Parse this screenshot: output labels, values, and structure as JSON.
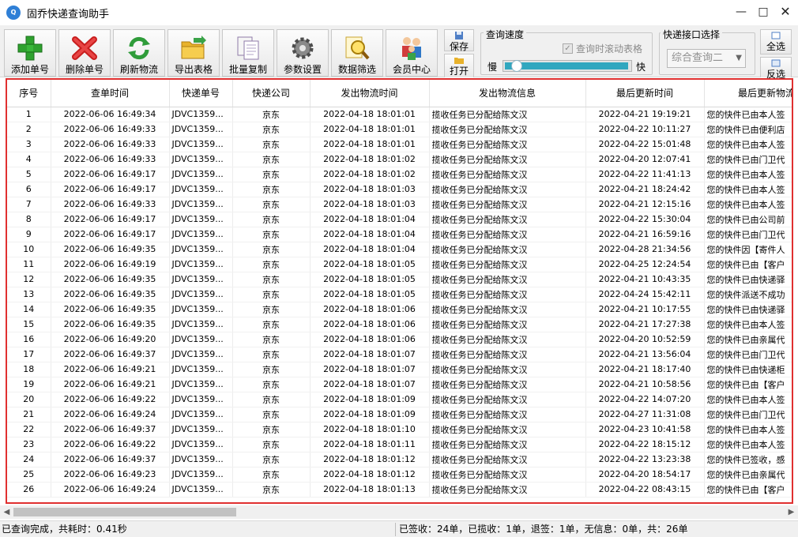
{
  "window": {
    "title": "固乔快递查询助手",
    "app_icon": "Q"
  },
  "toolbar": {
    "buttons": [
      {
        "label": "添加单号",
        "icon": "green-plus-icon"
      },
      {
        "label": "删除单号",
        "icon": "red-x-icon"
      },
      {
        "label": "刷新物流",
        "icon": "refresh-icon"
      },
      {
        "label": "导出表格",
        "icon": "folder-export-icon"
      },
      {
        "label": "批量复制",
        "icon": "copy-icon"
      },
      {
        "label": "参数设置",
        "icon": "gear-icon"
      },
      {
        "label": "数据筛选",
        "icon": "filter-search-icon"
      },
      {
        "label": "会员中心",
        "icon": "members-icon"
      }
    ],
    "save_label": "保存",
    "open_label": "打开",
    "speed": {
      "title": "查询速度",
      "scroll_checkbox_label": "查询时滚动表格",
      "scroll_checked": true,
      "slow_label": "慢",
      "fast_label": "快",
      "level": 0.06
    },
    "api": {
      "title": "快递接口选择",
      "selected": "综合查询二"
    },
    "select_all_label": "全选",
    "invert_label": "反选"
  },
  "grid": {
    "columns": [
      "序号",
      "查单时间",
      "快递单号",
      "快递公司",
      "发出物流时间",
      "发出物流信息",
      "最后更新时间",
      "最后更新物流"
    ],
    "rows": [
      [
        "1",
        "2022-06-06 16:49:34",
        "JDVC1359...",
        "京东",
        "2022-04-18 18:01:01",
        "揽收任务已分配给陈文汉",
        "2022-04-21 19:19:21",
        "您的快件已由本人签"
      ],
      [
        "2",
        "2022-06-06 16:49:33",
        "JDVC1359...",
        "京东",
        "2022-04-18 18:01:01",
        "揽收任务已分配给陈文汉",
        "2022-04-22 10:11:27",
        "您的快件已由便利店"
      ],
      [
        "3",
        "2022-06-06 16:49:33",
        "JDVC1359...",
        "京东",
        "2022-04-18 18:01:01",
        "揽收任务已分配给陈文汉",
        "2022-04-22 15:01:48",
        "您的快件已由本人签"
      ],
      [
        "4",
        "2022-06-06 16:49:33",
        "JDVC1359...",
        "京东",
        "2022-04-18 18:01:02",
        "揽收任务已分配给陈文汉",
        "2022-04-20 12:07:41",
        "您的快件已由门卫代"
      ],
      [
        "5",
        "2022-06-06 16:49:17",
        "JDVC1359...",
        "京东",
        "2022-04-18 18:01:02",
        "揽收任务已分配给陈文汉",
        "2022-04-22 11:41:13",
        "您的快件已由本人签"
      ],
      [
        "6",
        "2022-06-06 16:49:17",
        "JDVC1359...",
        "京东",
        "2022-04-18 18:01:03",
        "揽收任务已分配给陈文汉",
        "2022-04-21 18:24:42",
        "您的快件已由本人签"
      ],
      [
        "7",
        "2022-06-06 16:49:33",
        "JDVC1359...",
        "京东",
        "2022-04-18 18:01:03",
        "揽收任务已分配给陈文汉",
        "2022-04-21 12:15:16",
        "您的快件已由本人签"
      ],
      [
        "8",
        "2022-06-06 16:49:17",
        "JDVC1359...",
        "京东",
        "2022-04-18 18:01:04",
        "揽收任务已分配给陈文汉",
        "2022-04-22 15:30:04",
        "您的快件已由公司前"
      ],
      [
        "9",
        "2022-06-06 16:49:17",
        "JDVC1359...",
        "京东",
        "2022-04-18 18:01:04",
        "揽收任务已分配给陈文汉",
        "2022-04-21 16:59:16",
        "您的快件已由门卫代"
      ],
      [
        "10",
        "2022-06-06 16:49:35",
        "JDVC1359...",
        "京东",
        "2022-04-18 18:01:04",
        "揽收任务已分配给陈文汉",
        "2022-04-28 21:34:56",
        "您的快件因【寄件人"
      ],
      [
        "11",
        "2022-06-06 16:49:19",
        "JDVC1359...",
        "京东",
        "2022-04-18 18:01:05",
        "揽收任务已分配给陈文汉",
        "2022-04-25 12:24:54",
        "您的快件已由【客户"
      ],
      [
        "12",
        "2022-06-06 16:49:35",
        "JDVC1359...",
        "京东",
        "2022-04-18 18:01:05",
        "揽收任务已分配给陈文汉",
        "2022-04-21 10:43:35",
        "您的快件已由快递驿"
      ],
      [
        "13",
        "2022-06-06 16:49:35",
        "JDVC1359...",
        "京东",
        "2022-04-18 18:01:05",
        "揽收任务已分配给陈文汉",
        "2022-04-24 15:42:11",
        "您的快件派送不成功"
      ],
      [
        "14",
        "2022-06-06 16:49:35",
        "JDVC1359...",
        "京东",
        "2022-04-18 18:01:06",
        "揽收任务已分配给陈文汉",
        "2022-04-21 10:17:55",
        "您的快件已由快递驿"
      ],
      [
        "15",
        "2022-06-06 16:49:35",
        "JDVC1359...",
        "京东",
        "2022-04-18 18:01:06",
        "揽收任务已分配给陈文汉",
        "2022-04-21 17:27:38",
        "您的快件已由本人签"
      ],
      [
        "16",
        "2022-06-06 16:49:20",
        "JDVC1359...",
        "京东",
        "2022-04-18 18:01:06",
        "揽收任务已分配给陈文汉",
        "2022-04-20 10:52:59",
        "您的快件已由亲属代"
      ],
      [
        "17",
        "2022-06-06 16:49:37",
        "JDVC1359...",
        "京东",
        "2022-04-18 18:01:07",
        "揽收任务已分配给陈文汉",
        "2022-04-21 13:56:04",
        "您的快件已由门卫代"
      ],
      [
        "18",
        "2022-06-06 16:49:21",
        "JDVC1359...",
        "京东",
        "2022-04-18 18:01:07",
        "揽收任务已分配给陈文汉",
        "2022-04-21 18:17:40",
        "您的快件已由快递柜"
      ],
      [
        "19",
        "2022-06-06 16:49:21",
        "JDVC1359...",
        "京东",
        "2022-04-18 18:01:07",
        "揽收任务已分配给陈文汉",
        "2022-04-21 10:58:56",
        "您的快件已由【客户"
      ],
      [
        "20",
        "2022-06-06 16:49:22",
        "JDVC1359...",
        "京东",
        "2022-04-18 18:01:09",
        "揽收任务已分配给陈文汉",
        "2022-04-22 14:07:20",
        "您的快件已由本人签"
      ],
      [
        "21",
        "2022-06-06 16:49:24",
        "JDVC1359...",
        "京东",
        "2022-04-18 18:01:09",
        "揽收任务已分配给陈文汉",
        "2022-04-27 11:31:08",
        "您的快件已由门卫代"
      ],
      [
        "22",
        "2022-06-06 16:49:37",
        "JDVC1359...",
        "京东",
        "2022-04-18 18:01:10",
        "揽收任务已分配给陈文汉",
        "2022-04-23 10:41:58",
        "您的快件已由本人签"
      ],
      [
        "23",
        "2022-06-06 16:49:22",
        "JDVC1359...",
        "京东",
        "2022-04-18 18:01:11",
        "揽收任务已分配给陈文汉",
        "2022-04-22 18:15:12",
        "您的快件已由本人签"
      ],
      [
        "24",
        "2022-06-06 16:49:37",
        "JDVC1359...",
        "京东",
        "2022-04-18 18:01:12",
        "揽收任务已分配给陈文汉",
        "2022-04-22 13:23:38",
        "您的快件已签收，感"
      ],
      [
        "25",
        "2022-06-06 16:49:23",
        "JDVC1359...",
        "京东",
        "2022-04-18 18:01:12",
        "揽收任务已分配给陈文汉",
        "2022-04-20 18:54:17",
        "您的快件已由亲属代"
      ],
      [
        "26",
        "2022-06-06 16:49:24",
        "JDVC1359...",
        "京东",
        "2022-04-18 18:01:13",
        "揽收任务已分配给陈文汉",
        "2022-04-22 08:43:15",
        "您的快件已由【客户"
      ]
    ]
  },
  "status": {
    "left": "已查询完成，共耗时：0.41秒",
    "right": "已签收：24单，已揽收：1单，退签：1单，无信息：0单，共：26单"
  },
  "colors": {
    "grid_highlight_border": "#e03030",
    "speed_fill": "#31a7bf"
  }
}
